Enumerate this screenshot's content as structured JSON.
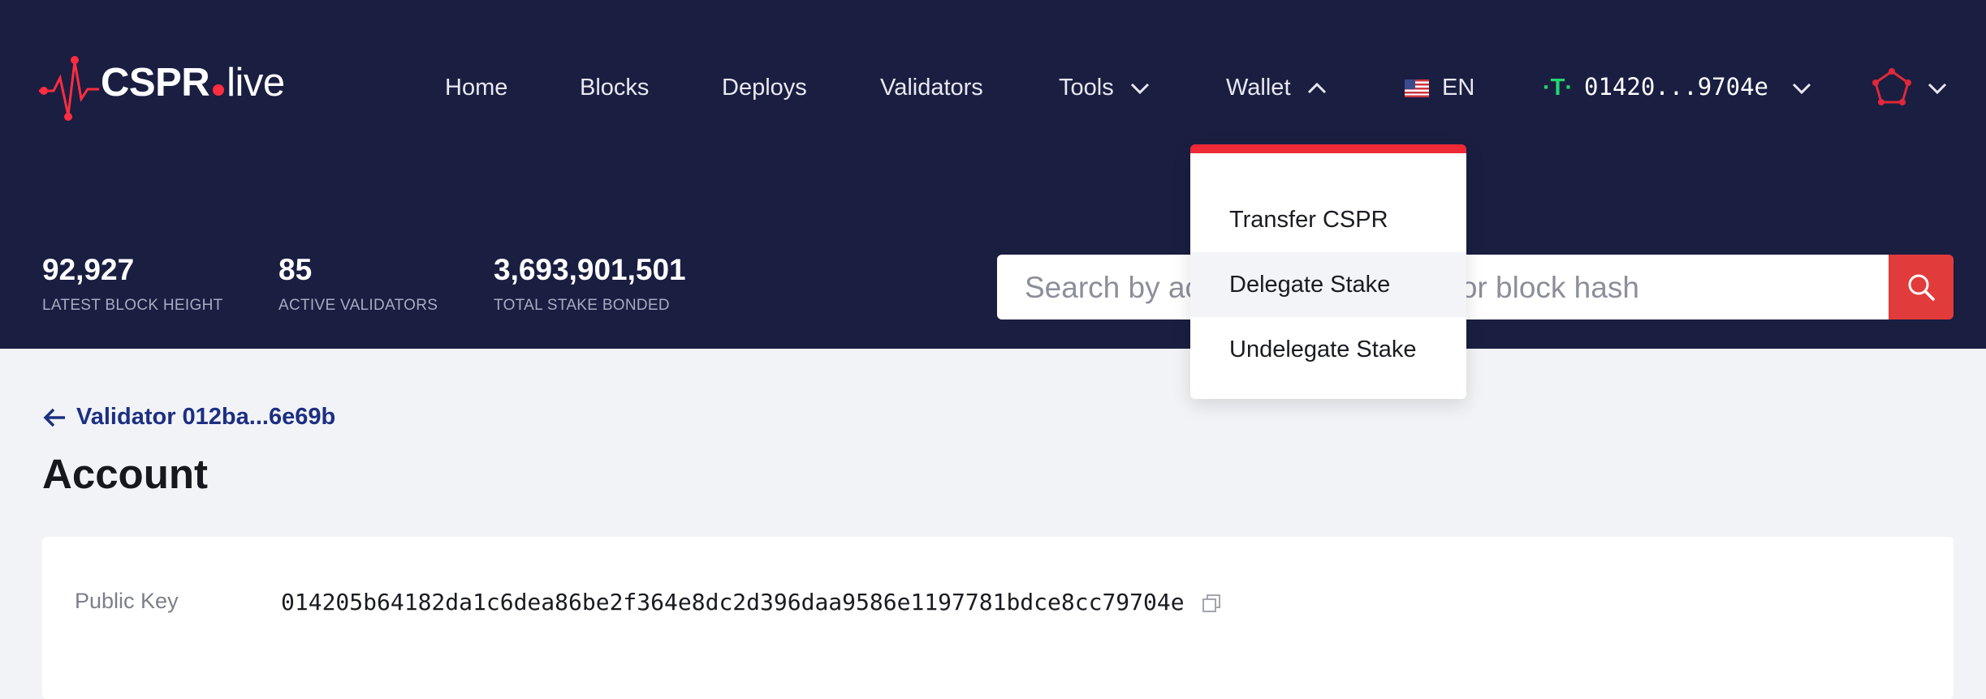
{
  "colors": {
    "header_bg": "#1a1e41",
    "accent_red": "#ee2a36",
    "brand_green": "#22d66e",
    "link_blue": "#1c2f82"
  },
  "logo": {
    "main": "CSPR",
    "suffix": "live"
  },
  "nav": {
    "home": "Home",
    "blocks": "Blocks",
    "deploys": "Deploys",
    "validators": "Validators",
    "tools": "Tools",
    "wallet": "Wallet",
    "language": "EN",
    "account": "01420...9704e"
  },
  "wallet_menu": {
    "items": [
      "Transfer CSPR",
      "Delegate Stake",
      "Undelegate Stake"
    ]
  },
  "stats": [
    {
      "value": "92,927",
      "label": "LATEST BLOCK HEIGHT"
    },
    {
      "value": "85",
      "label": "ACTIVE VALIDATORS"
    },
    {
      "value": "3,693,901,501",
      "label": "TOTAL STAKE BONDED"
    }
  ],
  "search": {
    "placeholder": "Search by account, deploy hash or block hash"
  },
  "breadcrumb": {
    "back_label": "Validator 012ba...6e69b"
  },
  "page": {
    "title": "Account"
  },
  "account": {
    "public_key_label": "Public Key",
    "public_key": "014205b64182da1c6dea86be2f364e8dc2d396daa9586e1197781bdce8cc79704e"
  },
  "icons": [
    "cspr-logo-icon",
    "chevron-down-icon",
    "chevron-up-icon",
    "us-flag-icon",
    "testnet-icon",
    "profile-icon",
    "search-icon",
    "arrow-left-icon",
    "copy-icon"
  ]
}
